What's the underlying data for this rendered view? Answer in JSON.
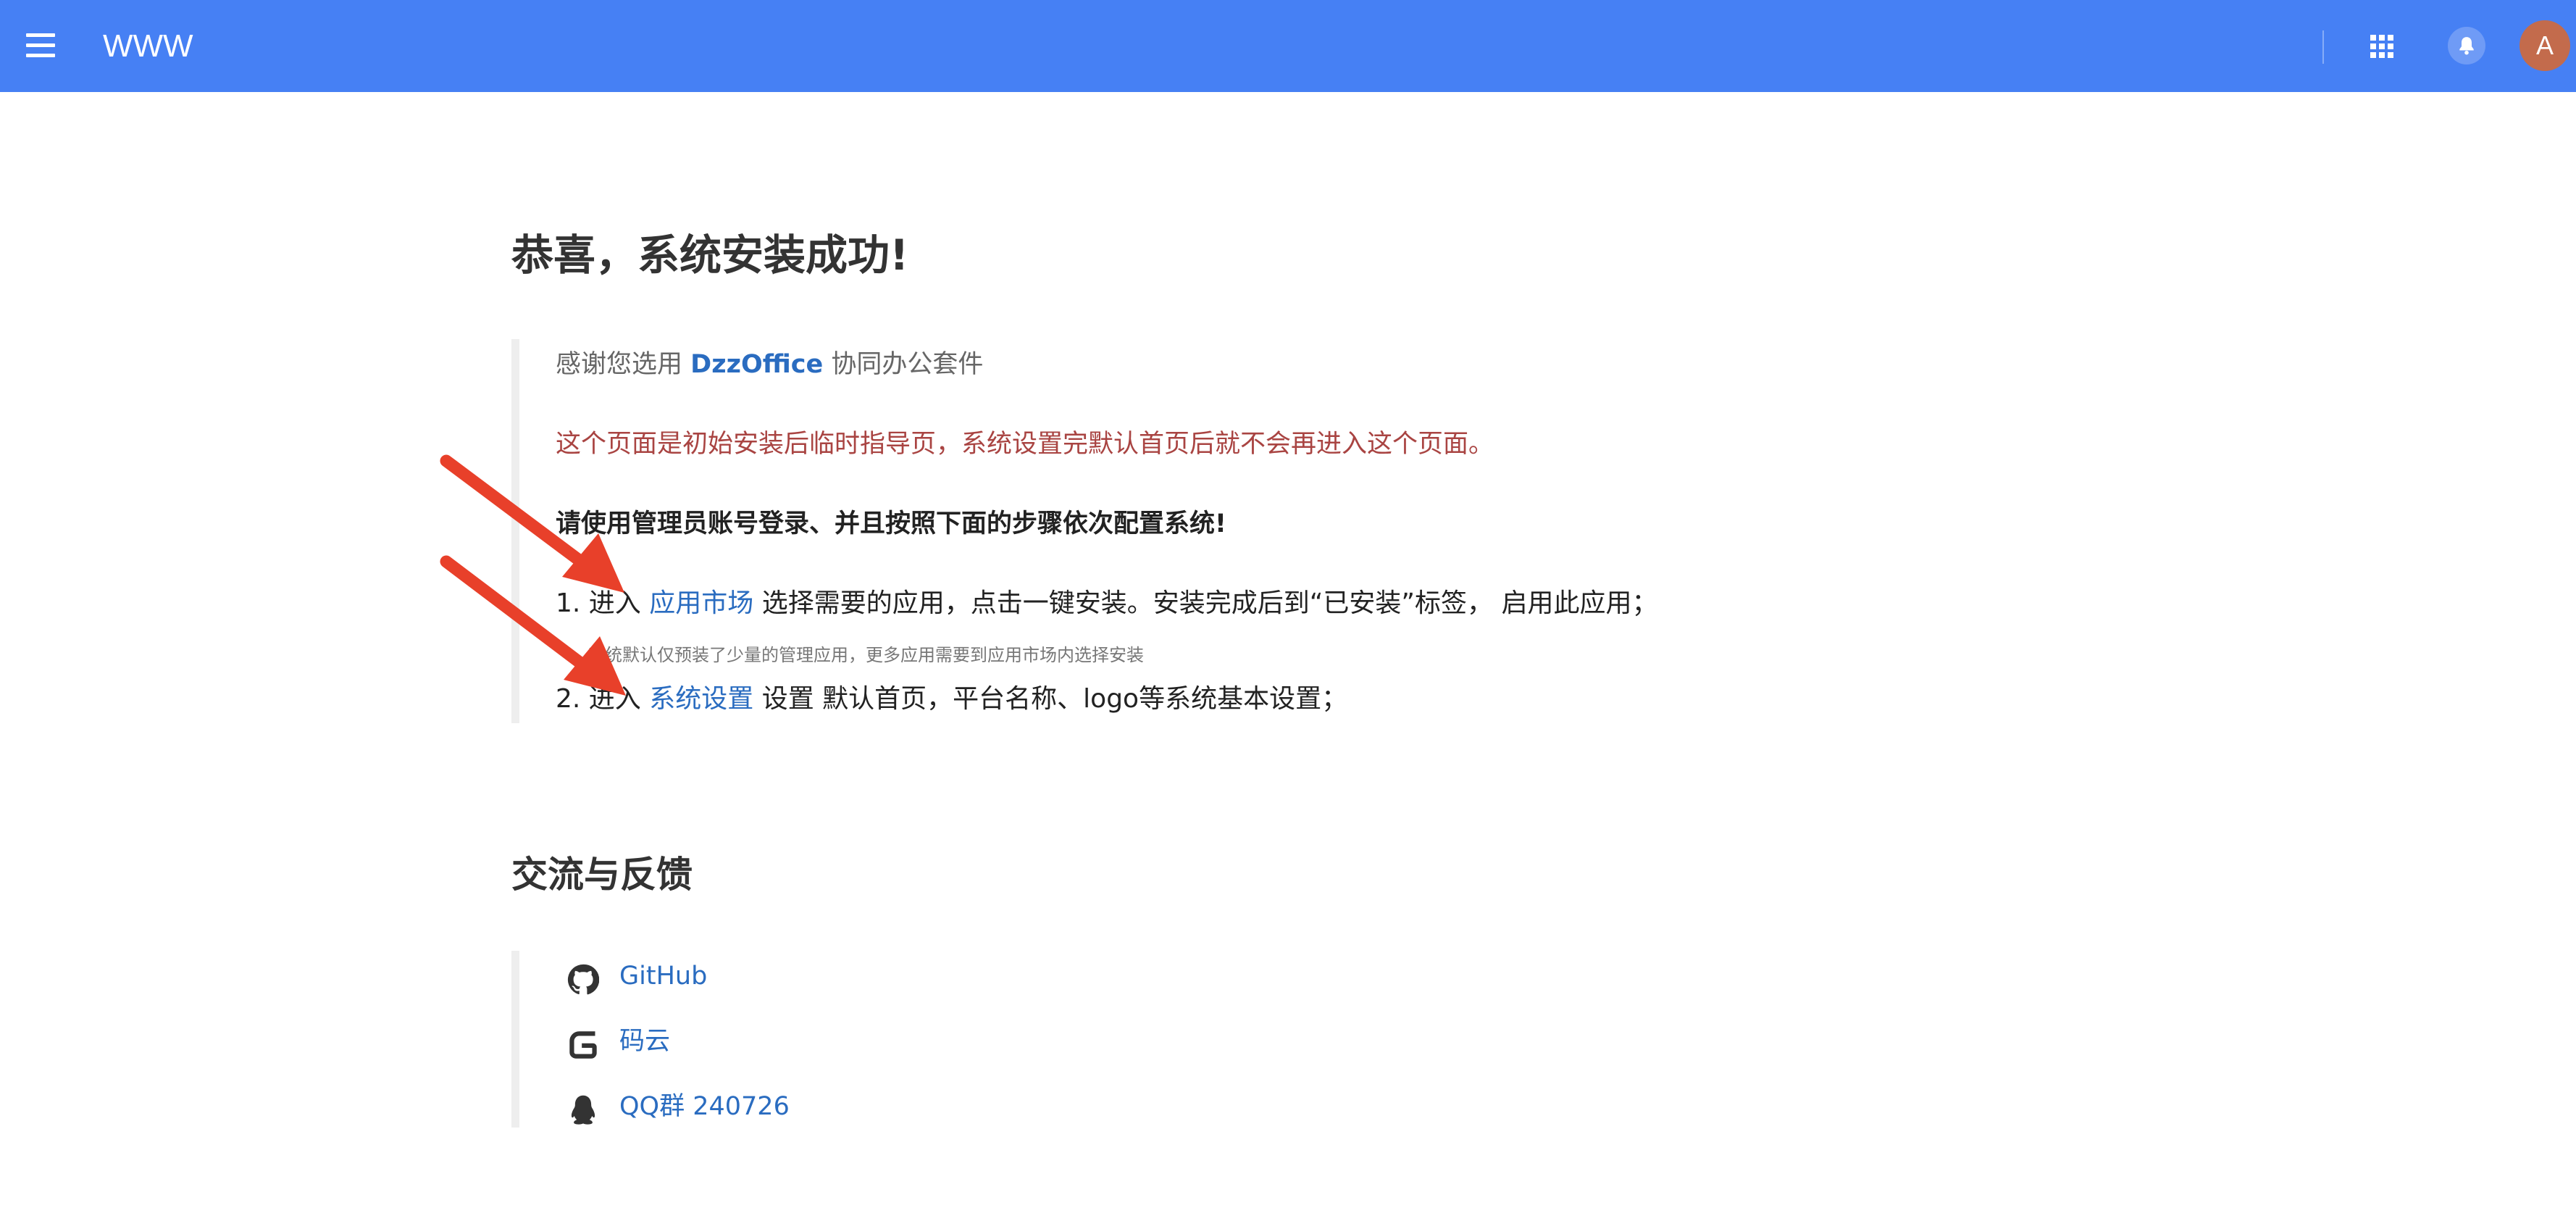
{
  "header": {
    "title": "WWW",
    "avatar_letter": "A",
    "bar_color": "#4680f4"
  },
  "main": {
    "title": "恭喜，系统安装成功!",
    "thanks_prefix": "感谢您选用",
    "brand": "DzzOffice",
    "thanks_suffix": "协同办公套件",
    "notice": "这个页面是初始安装后临时指导页，系统设置完默认首页后就不会再进入这个页面。",
    "instruction": "请使用管理员账号登录、并且按照下面的步骤依次配置系统!",
    "steps": [
      {
        "prefix": "1. 进入",
        "link": "应用市场",
        "suffix": "选择需要的应用，点击一键安装。安装完成后到“已安装”标签， 启用此应用；",
        "note": "系统默认仅预装了少量的管理应用，更多应用需要到应用市场内选择安装"
      },
      {
        "prefix": "2. 进入",
        "link": "系统设置",
        "suffix": "设置 默认首页，平台名称、logo等系统基本设置；"
      }
    ]
  },
  "feedback": {
    "title": "交流与反馈",
    "items": [
      {
        "label": "GitHub",
        "icon": "github-icon"
      },
      {
        "label": "码云",
        "icon": "gitee-icon"
      },
      {
        "label": "QQ群 240726",
        "icon": "qq-icon"
      }
    ]
  },
  "colors": {
    "link": "#2a6cc0",
    "notice": "#a94442",
    "arrow": "#e8402a"
  }
}
